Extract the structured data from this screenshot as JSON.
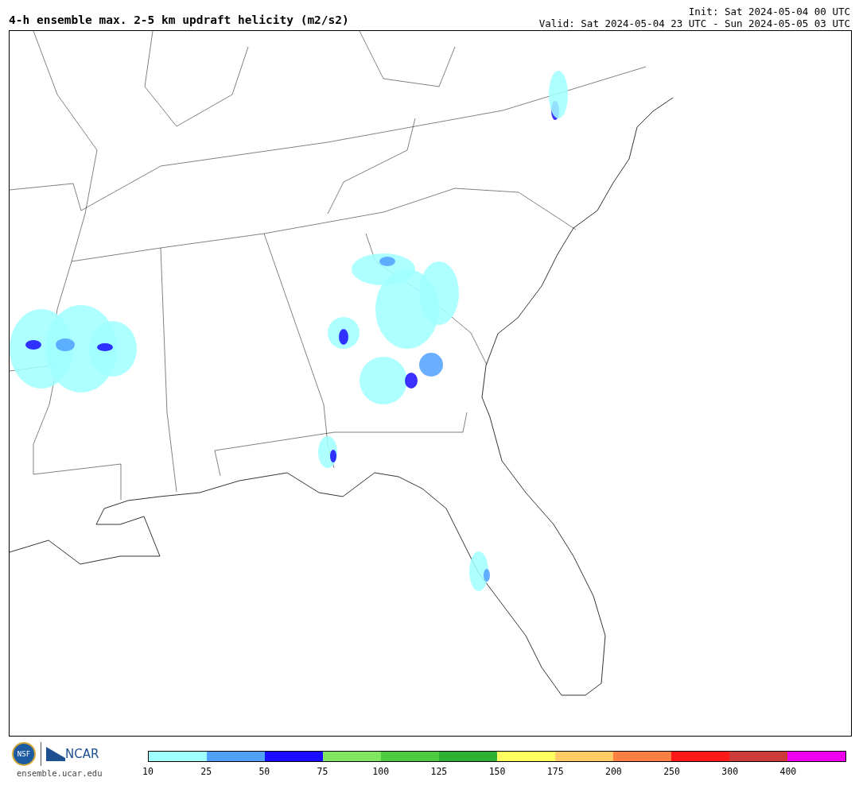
{
  "header": {
    "title": "4-h ensemble max. 2-5 km updraft helicity (m2/s2)",
    "init": "Init: Sat 2024-05-04 00 UTC",
    "valid": "Valid: Sat 2024-05-04 23 UTC - Sun 2024-05-05 03 UTC"
  },
  "logo": {
    "nsf": "NSF",
    "ncar": "NCAR",
    "url": "ensemble.ucar.edu"
  },
  "colorbar": {
    "segments": [
      {
        "color": "#a0ffff"
      },
      {
        "color": "#50a0ff"
      },
      {
        "color": "#1a0dff"
      },
      {
        "color": "#80e660"
      },
      {
        "color": "#4ccc40"
      },
      {
        "color": "#2eb033"
      },
      {
        "color": "#ffff60"
      },
      {
        "color": "#ffcc66"
      },
      {
        "color": "#ff8040"
      },
      {
        "color": "#ff1a1a"
      },
      {
        "color": "#cc3a3a"
      },
      {
        "color": "#ee00ee"
      }
    ],
    "labels": [
      "10",
      "25",
      "50",
      "75",
      "100",
      "125",
      "150",
      "175",
      "200",
      "250",
      "300",
      "400"
    ]
  }
}
